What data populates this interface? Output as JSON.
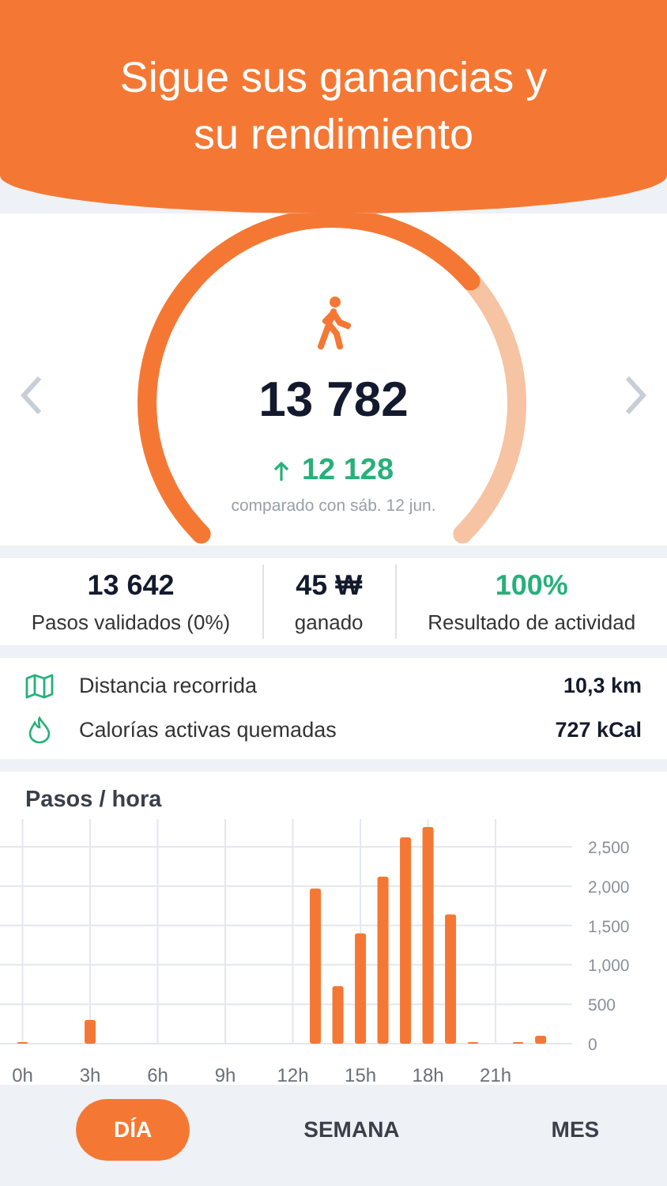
{
  "header": {
    "title": "Sigue sus ganancias y su rendimiento"
  },
  "gauge": {
    "steps": "13 782",
    "delta": "12 128",
    "comparison": "comparado con sáb. 12 jun."
  },
  "stats": [
    {
      "kind": "plain",
      "value": "13 642",
      "label": "Pasos validados (0%)"
    },
    {
      "kind": "plain",
      "value": "45 ₩",
      "label": "ganado"
    },
    {
      "kind": "highlight",
      "value": "100%",
      "label": "Resultado de actividad"
    }
  ],
  "metrics": [
    {
      "kind": "distance",
      "label": "Distancia recorrida",
      "value": "10,3 km"
    },
    {
      "kind": "calories",
      "label": "Calorías activas quemadas",
      "value": "727 kCal"
    }
  ],
  "chart": {
    "title": "Pasos / hora",
    "chart_data": {
      "type": "bar",
      "x": [
        0,
        1,
        2,
        3,
        4,
        5,
        6,
        7,
        8,
        9,
        10,
        11,
        12,
        13,
        14,
        15,
        16,
        17,
        18,
        19,
        20,
        21,
        22,
        23
      ],
      "values": [
        20,
        0,
        0,
        300,
        0,
        0,
        0,
        0,
        0,
        0,
        0,
        0,
        0,
        1970,
        730,
        1400,
        2120,
        2620,
        2750,
        1640,
        20,
        0,
        20,
        100
      ],
      "xticks": [
        {
          "value": 0,
          "label": "0h"
        },
        {
          "value": 3,
          "label": "3h"
        },
        {
          "value": 6,
          "label": "6h"
        },
        {
          "value": 9,
          "label": "9h"
        },
        {
          "value": 12,
          "label": "12h"
        },
        {
          "value": 15,
          "label": "15h"
        },
        {
          "value": 18,
          "label": "18h"
        },
        {
          "value": 21,
          "label": "21h"
        }
      ],
      "yticks": [
        {
          "value": 0,
          "label": "0"
        },
        {
          "value": 500,
          "label": "500"
        },
        {
          "value": 1000,
          "label": "1,000"
        },
        {
          "value": 1500,
          "label": "1,500"
        },
        {
          "value": 2000,
          "label": "2,000"
        },
        {
          "value": 2500,
          "label": "2,500"
        }
      ],
      "xlim": [
        -1,
        24.4
      ],
      "ylim": [
        0,
        2750
      ],
      "grid": true
    }
  },
  "tabs": [
    {
      "label": "DÍA",
      "selected": true
    },
    {
      "label": "SEMANA",
      "selected": false
    },
    {
      "label": "MES",
      "selected": false
    }
  ]
}
